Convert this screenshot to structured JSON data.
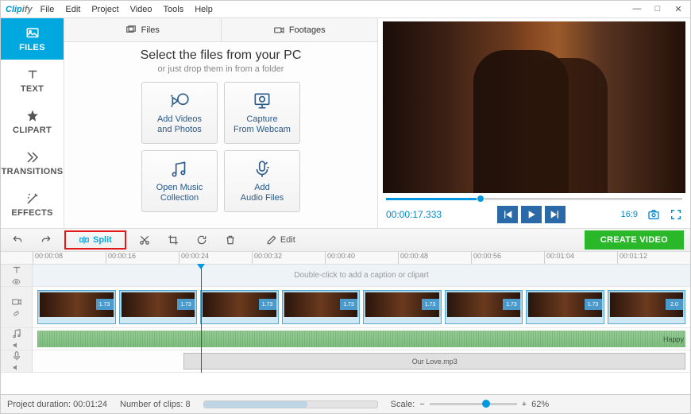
{
  "app": {
    "brand_a": "Clip",
    "brand_b": "ify"
  },
  "menu": [
    "File",
    "Edit",
    "Project",
    "Video",
    "Tools",
    "Help"
  ],
  "sidebar": [
    {
      "id": "files",
      "label": "FILES"
    },
    {
      "id": "text",
      "label": "TEXT"
    },
    {
      "id": "clipart",
      "label": "CLIPART"
    },
    {
      "id": "transitions",
      "label": "TRANSITIONS"
    },
    {
      "id": "effects",
      "label": "EFFECTS"
    }
  ],
  "mediaTabs": {
    "files": "Files",
    "footages": "Footages"
  },
  "mediaPanel": {
    "title": "Select the files from your PC",
    "subtitle": "or just drop them in from a folder",
    "tiles": [
      {
        "l1": "Add Videos",
        "l2": "and Photos"
      },
      {
        "l1": "Capture",
        "l2": "From Webcam"
      },
      {
        "l1": "Open Music",
        "l2": "Collection"
      },
      {
        "l1": "Add",
        "l2": "Audio Files"
      }
    ]
  },
  "preview": {
    "time": "00:00:17.333",
    "ratio": "16:9"
  },
  "toolbar": {
    "split": "Split",
    "edit": "Edit",
    "create": "CREATE VIDEO"
  },
  "ruler": [
    "00:00:08",
    "00:00:16",
    "00:00:24",
    "00:00:32",
    "00:00:40",
    "00:00:48",
    "00:00:56",
    "00:01:04",
    "00:01:12"
  ],
  "captionHint": "Double-click to add a caption or clipart",
  "clips": [
    {
      "d": "1.73"
    },
    {
      "d": "1.73"
    },
    {
      "d": "1.73"
    },
    {
      "d": "1.73"
    },
    {
      "d": "1.73"
    },
    {
      "d": "1.73"
    },
    {
      "d": "1.73"
    },
    {
      "d": "2.0"
    }
  ],
  "audio1": {
    "label": "Happy"
  },
  "audio2": {
    "label": "Our Love.mp3"
  },
  "status": {
    "duration_l": "Project duration:",
    "duration_v": "00:01:24",
    "clips_l": "Number of clips:",
    "clips_v": "8",
    "scale_l": "Scale:",
    "zoom": "62%"
  }
}
